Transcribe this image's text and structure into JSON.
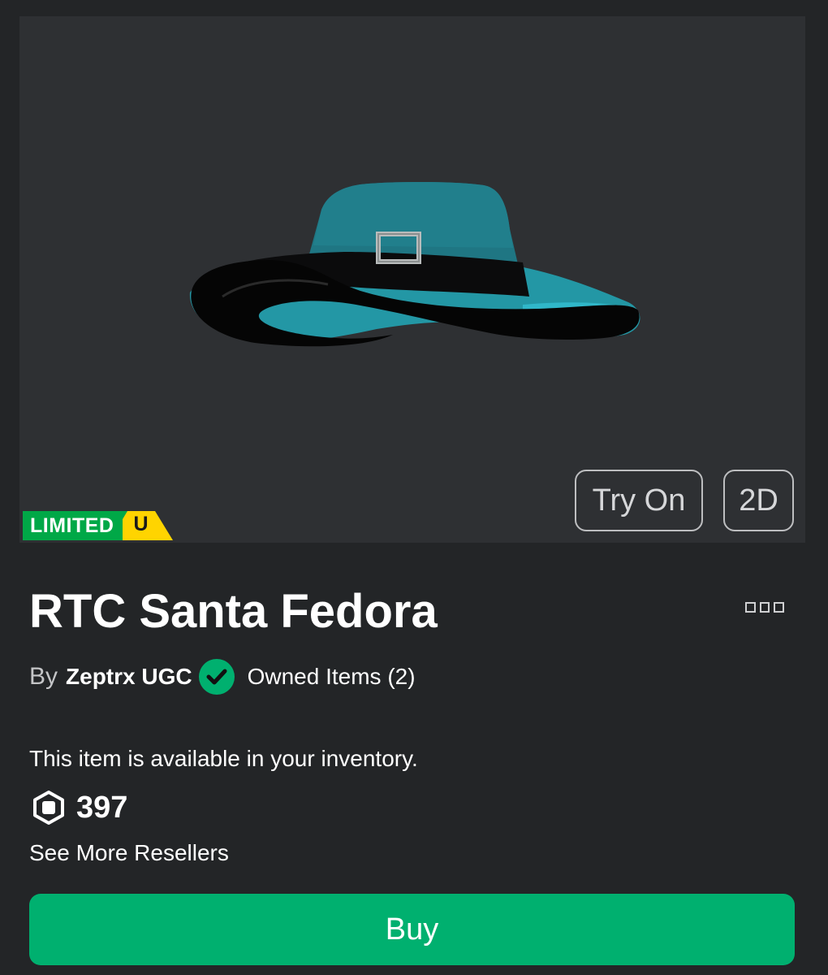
{
  "preview": {
    "try_on_label": "Try On",
    "two_d_label": "2D",
    "limited_label": "LIMITED",
    "limited_tag": "U"
  },
  "item": {
    "title": "RTC Santa Fedora",
    "by_label": "By",
    "creator": "Zeptrx UGC",
    "owned_items": "Owned Items (2)",
    "availability": "This item is available in your inventory.",
    "price": "397",
    "resellers_link": "See More Resellers",
    "buy_label": "Buy"
  },
  "icons": {
    "more": "more-options-icon",
    "verified": "verified-badge-icon",
    "currency": "robux-icon"
  },
  "colors": {
    "background": "#232527",
    "preview_background": "#2e3033",
    "buy_button": "#00b06f",
    "limited_green": "#00a847",
    "limited_yellow": "#ffd400",
    "verified_green": "#00b06f",
    "hat_teal": "#1d7f8c"
  }
}
